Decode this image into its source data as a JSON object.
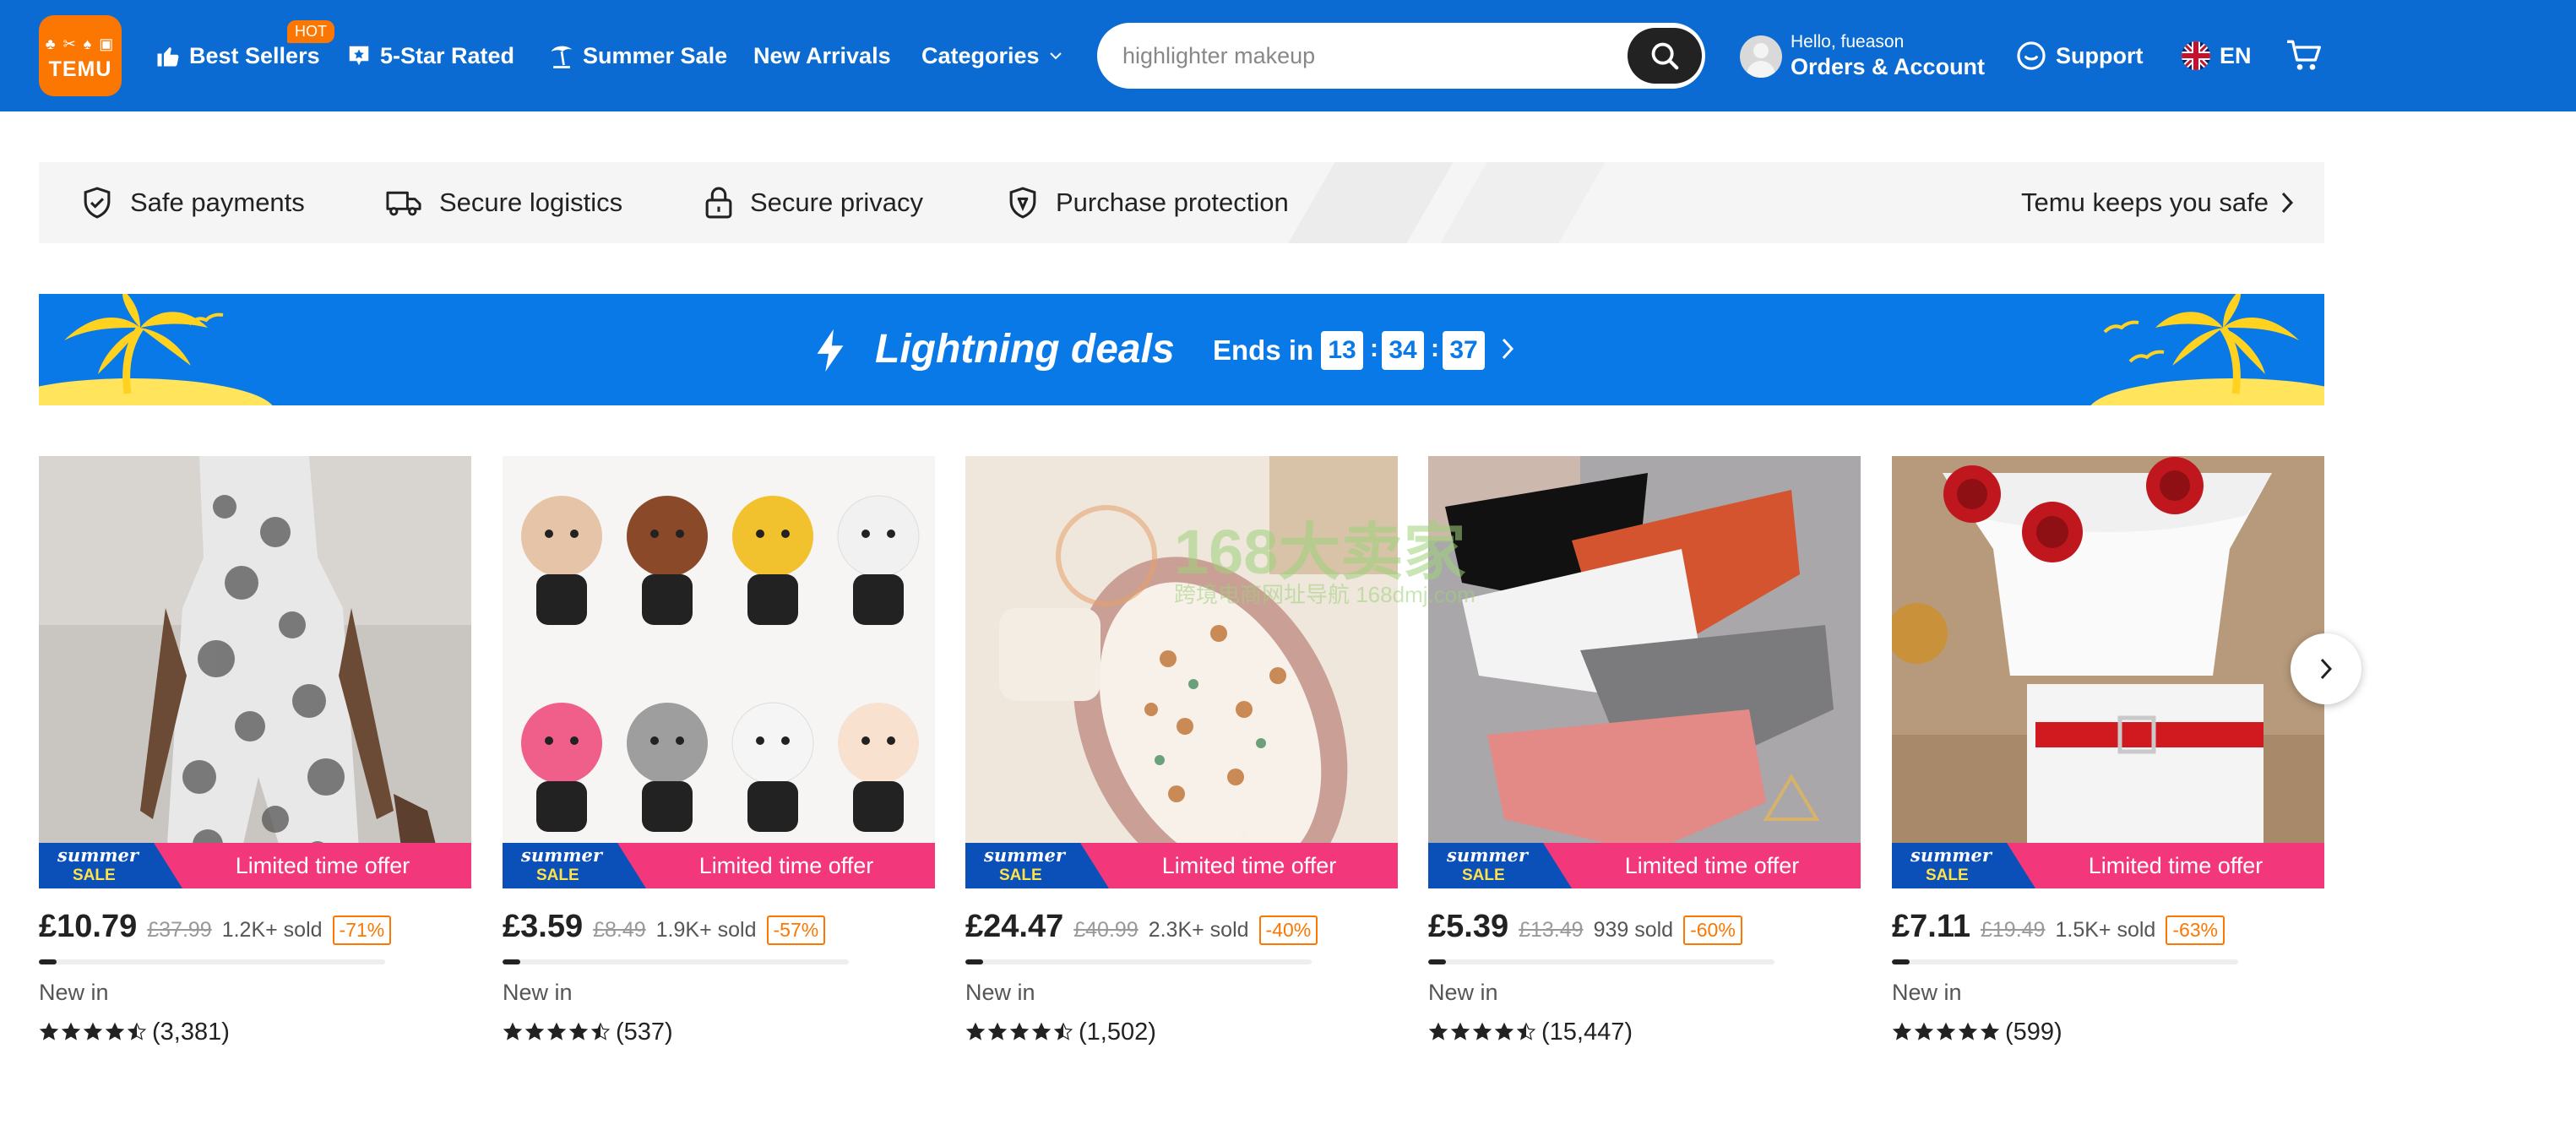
{
  "header": {
    "logo_text": "TEMU",
    "nav": [
      {
        "label": "Best Sellers",
        "icon": "thumbs-up-icon",
        "badge": "HOT"
      },
      {
        "label": "5-Star Rated",
        "icon": "star-badge-icon"
      },
      {
        "label": "Summer Sale",
        "icon": "palm-umbrella-icon"
      },
      {
        "label": "New Arrivals"
      },
      {
        "label": "Categories",
        "icon": "chevron-down-icon"
      }
    ],
    "search": {
      "placeholder": "highlighter makeup"
    },
    "account": {
      "greeting": "Hello, fueason",
      "label": "Orders & Account"
    },
    "support_label": "Support",
    "language_label": "EN"
  },
  "trust_bar": {
    "items": [
      {
        "label": "Safe payments",
        "icon": "shield-check-icon"
      },
      {
        "label": "Secure logistics",
        "icon": "truck-icon"
      },
      {
        "label": "Secure privacy",
        "icon": "lock-icon"
      },
      {
        "label": "Purchase protection",
        "icon": "shield-badge-icon"
      }
    ],
    "link_label": "Temu keeps you safe"
  },
  "lightning_deals": {
    "title": "Lightning deals",
    "ends_label": "Ends in",
    "timer": {
      "hours": "13",
      "minutes": "34",
      "seconds": "37"
    }
  },
  "products": [
    {
      "price": "£10.79",
      "original_price": "£37.99",
      "sold": "1.2K+ sold",
      "discount": "-71%",
      "offer": "Limited time offer",
      "badge_line1": "summer",
      "badge_line2": "SALE",
      "tag": "New in",
      "rating": 4.5,
      "reviews": "(3,381)",
      "progress": 0.05
    },
    {
      "price": "£3.59",
      "original_price": "£8.49",
      "sold": "1.9K+ sold",
      "discount": "-57%",
      "offer": "Limited time offer",
      "badge_line1": "summer",
      "badge_line2": "SALE",
      "tag": "New in",
      "rating": 4.5,
      "reviews": "(537)",
      "progress": 0.05
    },
    {
      "price": "£24.47",
      "original_price": "£40.99",
      "sold": "2.3K+ sold",
      "discount": "-40%",
      "offer": "Limited time offer",
      "badge_line1": "summer",
      "badge_line2": "SALE",
      "tag": "New in",
      "rating": 4.5,
      "reviews": "(1,502)",
      "progress": 0.05
    },
    {
      "price": "£5.39",
      "original_price": "£13.49",
      "sold": "939 sold",
      "discount": "-60%",
      "offer": "Limited time offer",
      "badge_line1": "summer",
      "badge_line2": "SALE",
      "tag": "New in",
      "rating": 4.5,
      "reviews": "(15,447)",
      "progress": 0.05
    },
    {
      "price": "£7.11",
      "original_price": "£19.49",
      "sold": "1.5K+ sold",
      "discount": "-63%",
      "offer": "Limited time offer",
      "badge_line1": "summer",
      "badge_line2": "SALE",
      "tag": "New in",
      "rating": 5,
      "reviews": "(599)",
      "progress": 0.05
    }
  ],
  "watermark": {
    "title": "168大卖家",
    "subtitle": "跨境电商网址导航 168dmj.com"
  },
  "colors": {
    "brand_blue": "#0b6bd3",
    "deals_blue": "#0a79e8",
    "orange": "#fb7701",
    "offer_pink": "#f2387a"
  }
}
